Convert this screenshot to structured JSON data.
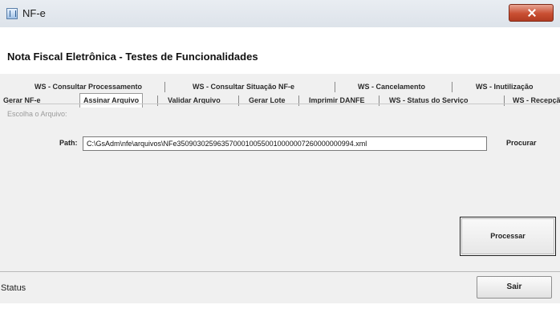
{
  "window": {
    "title": "NF-e",
    "close_icon": "close-icon"
  },
  "header": {
    "title": "Nota Fiscal Eletrônica - Testes de Funcionalidades"
  },
  "tabs": {
    "top_row": [
      {
        "label": "WS - Consultar Processamento"
      },
      {
        "label": "WS - Consultar Situação NF-e"
      },
      {
        "label": "WS - Cancelamento"
      },
      {
        "label": "WS - Inutilização"
      }
    ],
    "bottom_row": [
      {
        "label": "Gerar NF-e"
      },
      {
        "label": "Assinar Arquivo",
        "active": true
      },
      {
        "label": "Validar Arquivo"
      },
      {
        "label": "Gerar Lote"
      },
      {
        "label": "Imprimir DANFE"
      },
      {
        "label": "WS - Status do Serviço"
      },
      {
        "label": "WS - Recepção"
      }
    ]
  },
  "panel": {
    "group_label": "Escolha o Arquivo:",
    "path_label": "Path:",
    "path_value": "C:\\GsAdm\\nfe\\arquivos\\NFe35090302596357000100550010000007260000000994.xml",
    "browse_label": "Procurar",
    "process_label": "Processar"
  },
  "statusbar": {
    "status_label": "Status",
    "exit_label": "Sair"
  }
}
